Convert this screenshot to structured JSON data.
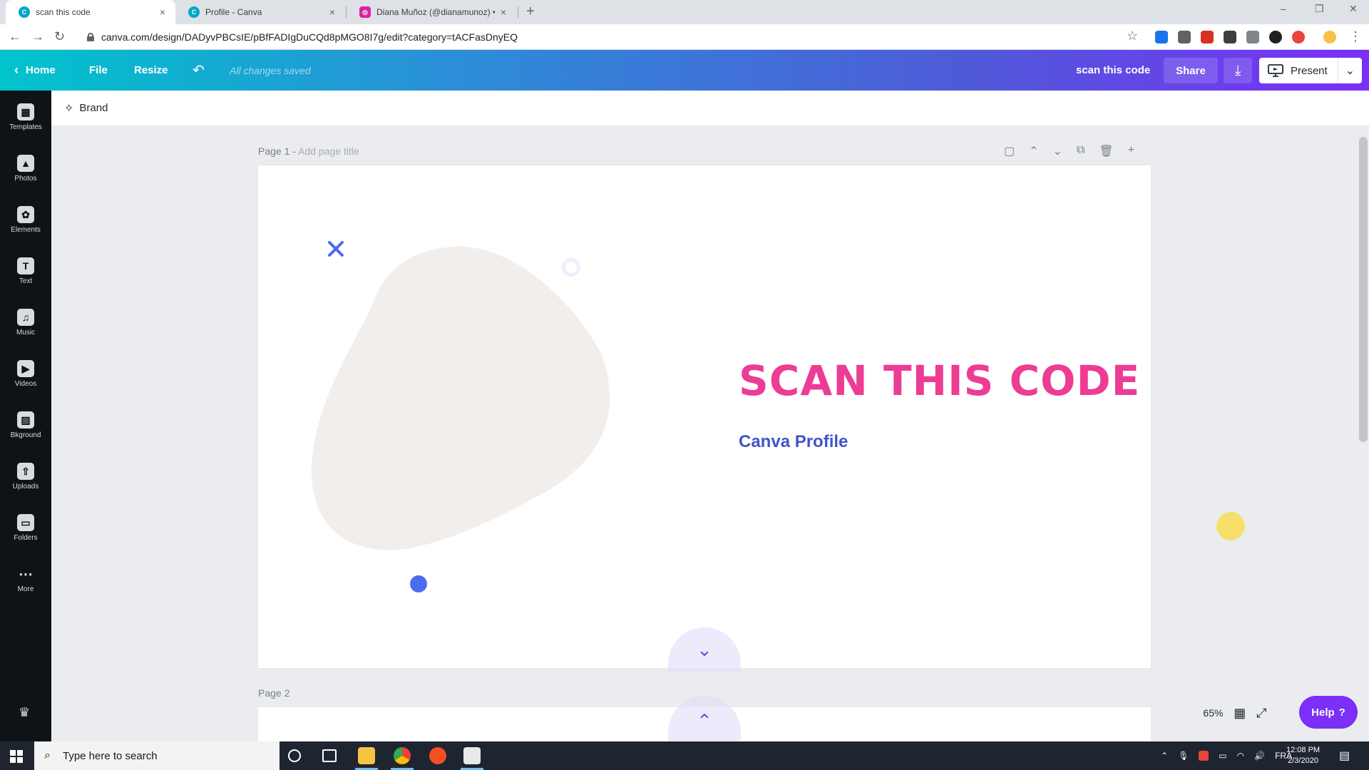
{
  "browser": {
    "tabs": [
      {
        "title": "scan this code",
        "close": "×",
        "favicon": "canva-favicon",
        "fav_color": "#00a6c8"
      },
      {
        "title": "Profile - Canva",
        "close": "×",
        "favicon": "canva-favicon",
        "fav_color": "#00a6c8"
      },
      {
        "title": "Diana Muñoz (@dianamunoz) • I",
        "close": "×",
        "favicon": "instagram-favicon",
        "fav_color": "#d6249f"
      }
    ],
    "new_tab": "+",
    "url": "canva.com/design/DADyvPBCsIE/pBfFADIgDuCQd8pMGO8I7g/edit?category=tACFasDnyEQ",
    "window_controls": {
      "minimize": "–",
      "restore": "❐",
      "close": "✕"
    },
    "nav": {
      "back": "←",
      "forward": "→",
      "reload": "↻"
    },
    "bookmark_star": "☆"
  },
  "canva_header": {
    "home_label": "Home",
    "file_label": "File",
    "resize_label": "Resize",
    "undo_icon": "↶",
    "saved_status": "All changes saved",
    "design_title": "scan this code",
    "share_label": "Share",
    "download_icon": "⤓",
    "present_label": "Present",
    "present_menu": "⌄"
  },
  "rail": [
    {
      "label": "Templates",
      "icon": "templates-icon",
      "glyph": "▦"
    },
    {
      "label": "Photos",
      "icon": "photos-icon",
      "glyph": "▲"
    },
    {
      "label": "Elements",
      "icon": "elements-icon",
      "glyph": "✿"
    },
    {
      "label": "Text",
      "icon": "text-icon",
      "glyph": "T"
    },
    {
      "label": "Music",
      "icon": "music-icon",
      "glyph": "♫"
    },
    {
      "label": "Videos",
      "icon": "videos-icon",
      "glyph": "▶"
    },
    {
      "label": "Bkground",
      "icon": "background-icon",
      "glyph": "▨"
    },
    {
      "label": "Uploads",
      "icon": "uploads-icon",
      "glyph": "⇧"
    },
    {
      "label": "Folders",
      "icon": "folders-icon",
      "glyph": "▭"
    },
    {
      "label": "More",
      "icon": "more-icon",
      "glyph": "⋯"
    }
  ],
  "rail_crown": "♛",
  "brand_bar": {
    "label": "Brand",
    "icon": "brand-sparkle-icon",
    "glyph": "✧"
  },
  "page1": {
    "label": "Page 1 - ",
    "add_title": "Add page title",
    "tools": {
      "notes": "▢",
      "up": "⌃",
      "down": "⌄",
      "duplicate": "⧉",
      "delete": "🗑",
      "add": "+"
    },
    "headline": "SCAN THIS CODE",
    "subline": "Canva Profile"
  },
  "page2": {
    "label": "Page 2"
  },
  "scroll_arrows": {
    "down": "⌄",
    "up": "⌃"
  },
  "zoom": {
    "value": "65%",
    "grid_icon": "▦",
    "fullscreen_icon": "⤢"
  },
  "help": {
    "label": "Help",
    "icon": "?"
  },
  "colors": {
    "headline_pink": "#ed3c94",
    "subline_blue": "#4055c9",
    "accent_purple": "#7b2ff7",
    "blob_beige": "#f2eeec",
    "deco_blue": "#4b6bf0"
  },
  "taskbar": {
    "search_placeholder": "Type here to search",
    "tray_lang": "FRA",
    "tray_time": "12:08 PM",
    "tray_date": "2/3/2020"
  }
}
